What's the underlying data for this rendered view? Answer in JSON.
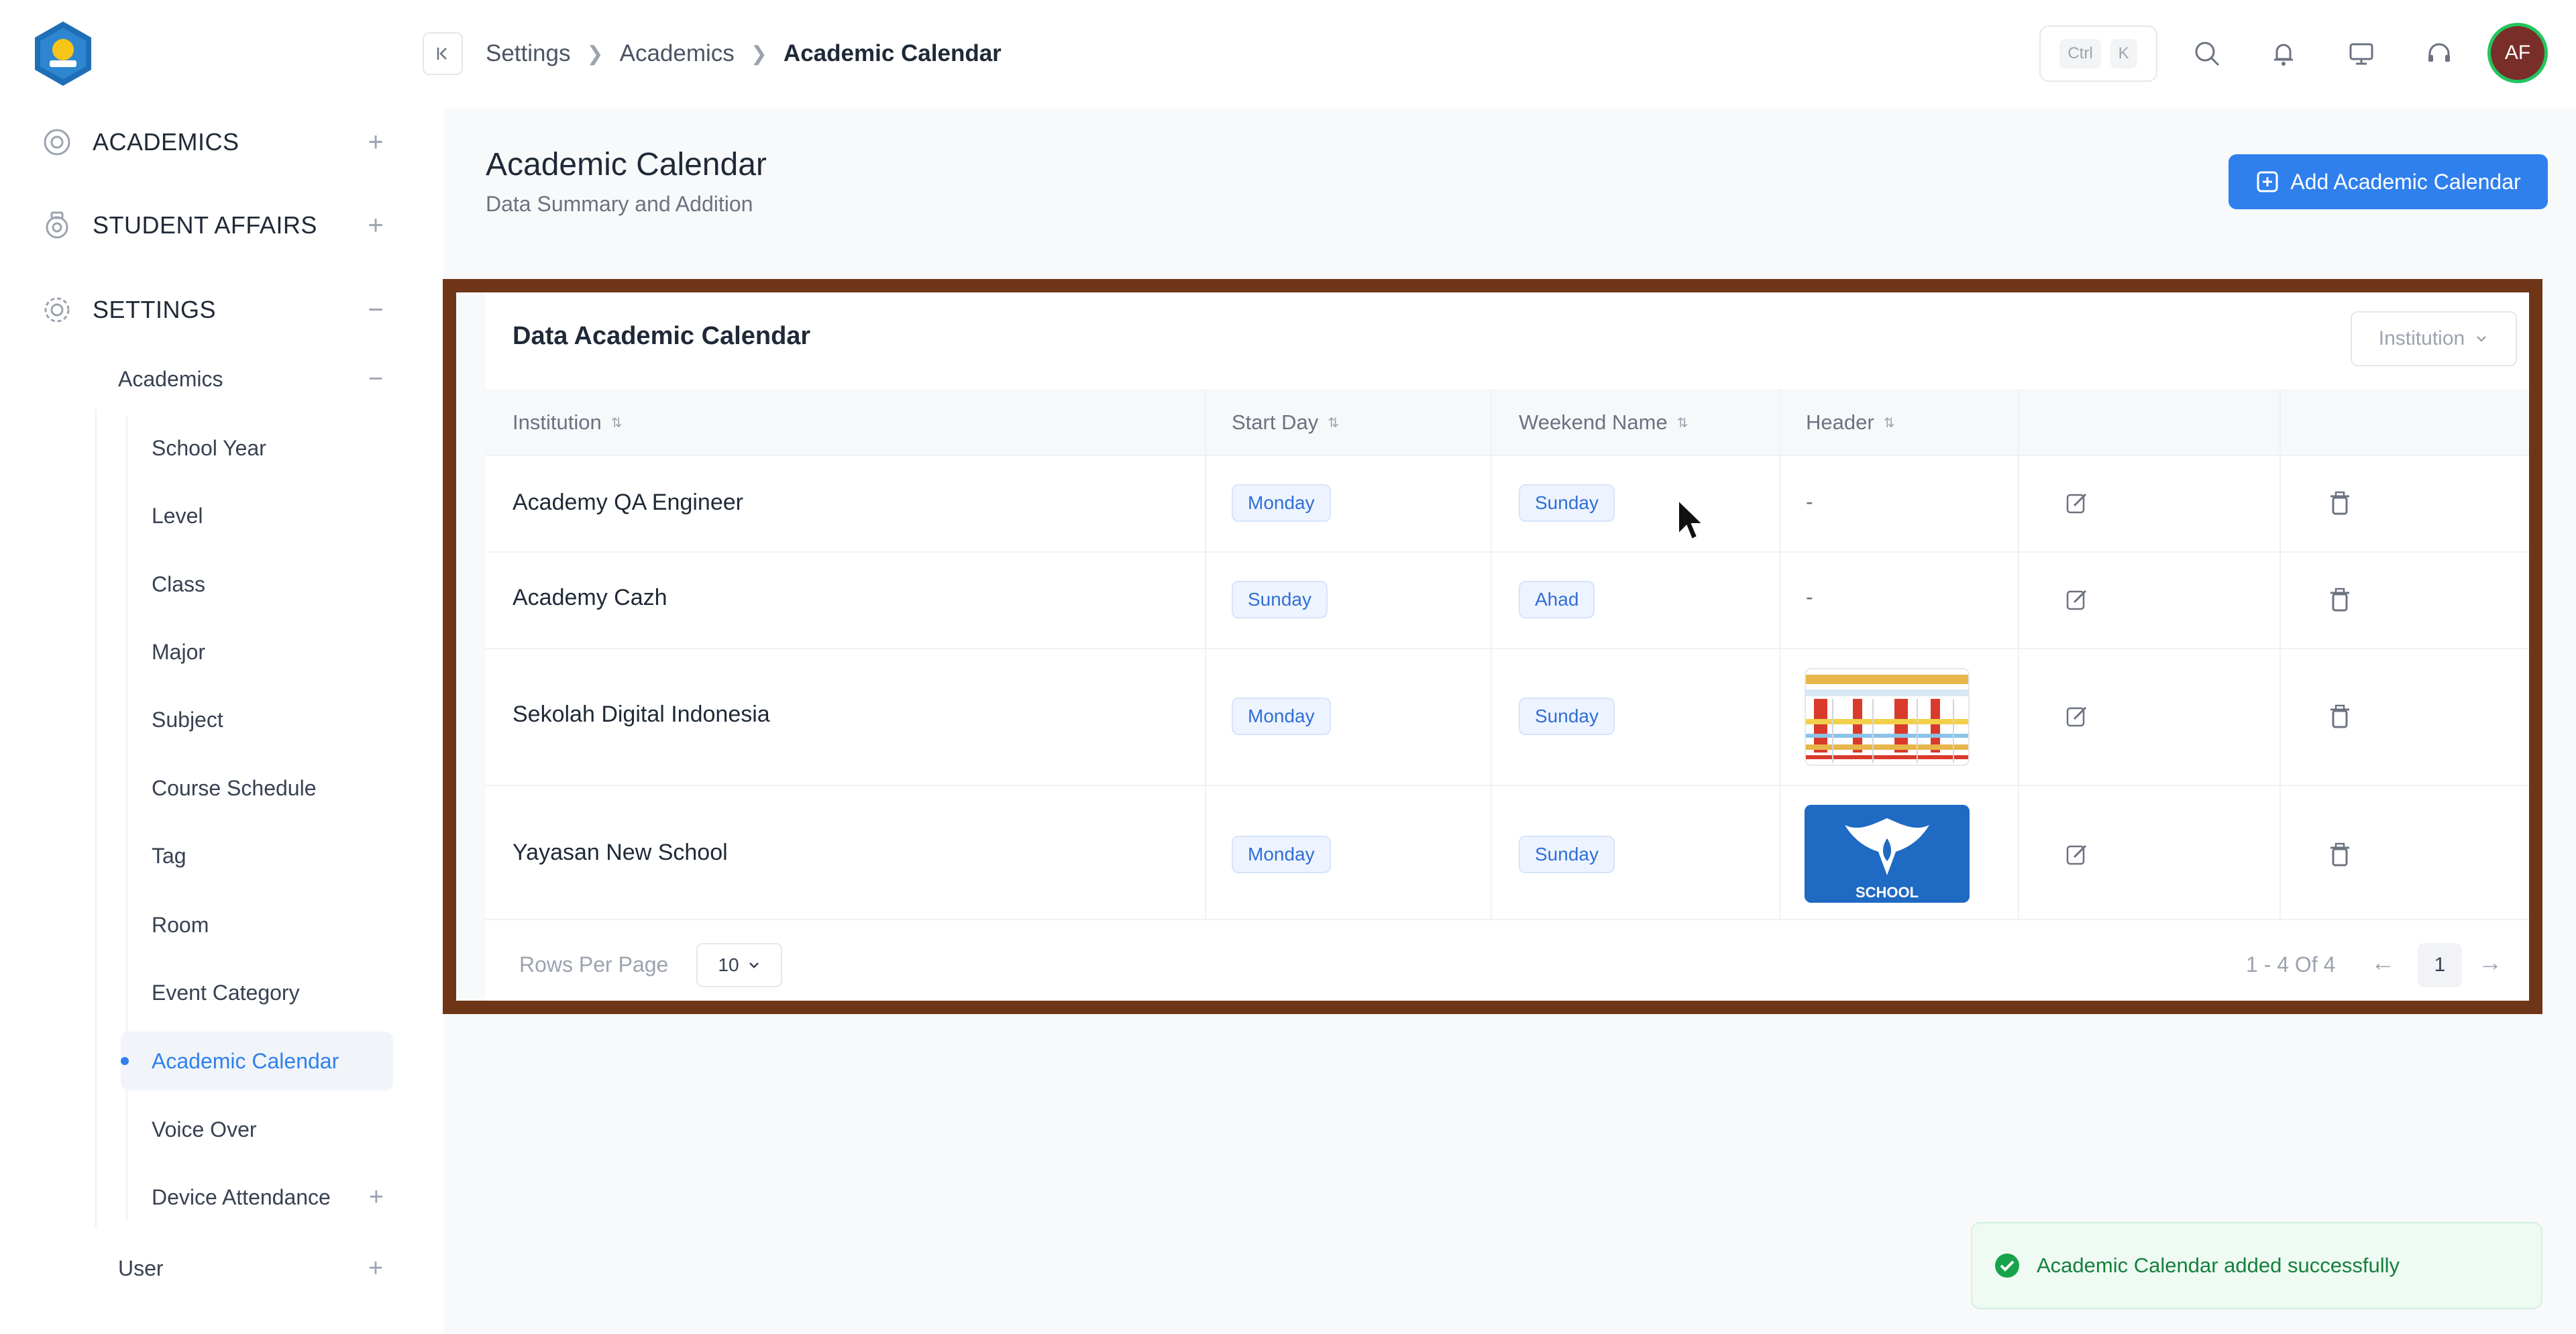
{
  "sidebar": {
    "groups": [
      {
        "label": "ACADEMICS",
        "toggle": "+"
      },
      {
        "label": "STUDENT AFFAIRS",
        "toggle": "+"
      },
      {
        "label": "SETTINGS",
        "toggle": "−"
      }
    ],
    "sub": {
      "academics": {
        "label": "Academics",
        "toggle": "−"
      },
      "user": {
        "label": "User",
        "toggle": "+"
      }
    },
    "items": [
      {
        "label": "School Year"
      },
      {
        "label": "Level"
      },
      {
        "label": "Class"
      },
      {
        "label": "Major"
      },
      {
        "label": "Subject"
      },
      {
        "label": "Course Schedule"
      },
      {
        "label": "Tag"
      },
      {
        "label": "Room"
      },
      {
        "label": "Event Category"
      },
      {
        "label": "Academic Calendar",
        "active": true
      },
      {
        "label": "Voice Over"
      },
      {
        "label": "Device Attendance",
        "toggle": "+"
      }
    ]
  },
  "breadcrumb": [
    "Settings",
    "Academics",
    "Academic Calendar"
  ],
  "shortcut": {
    "ctrl": "Ctrl",
    "key": "K"
  },
  "user": {
    "initials": "AF"
  },
  "page": {
    "title": "Academic Calendar",
    "subtitle": "Data Summary and Addition",
    "add_button": "Add Academic Calendar"
  },
  "table": {
    "title": "Data Academic Calendar",
    "filter_placeholder": "Institution",
    "columns": [
      "Institution",
      "Start Day",
      "Weekend Name",
      "Header"
    ],
    "rows": [
      {
        "institution": "Academy QA Engineer",
        "start_day": "Monday",
        "weekend": "Sunday",
        "header": "-"
      },
      {
        "institution": "Academy Cazh",
        "start_day": "Sunday",
        "weekend": "Ahad",
        "header": "-"
      },
      {
        "institution": "Sekolah Digital Indonesia",
        "start_day": "Monday",
        "weekend": "Sunday",
        "header": "calendar-image"
      },
      {
        "institution": "Yayasan New School",
        "start_day": "Monday",
        "weekend": "Sunday",
        "header": "school-logo-image"
      }
    ],
    "school_logo_text": "SCHOOL"
  },
  "pagination": {
    "rows_label": "Rows Per Page",
    "rows_value": "10",
    "range": "1 - 4 Of 4",
    "prev": "←",
    "next": "→",
    "page": "1"
  },
  "toast": {
    "message": "Academic Calendar added successfully"
  },
  "colors": {
    "accent": "#2f80ed",
    "frame": "#6e3617",
    "success": "#15803d"
  }
}
